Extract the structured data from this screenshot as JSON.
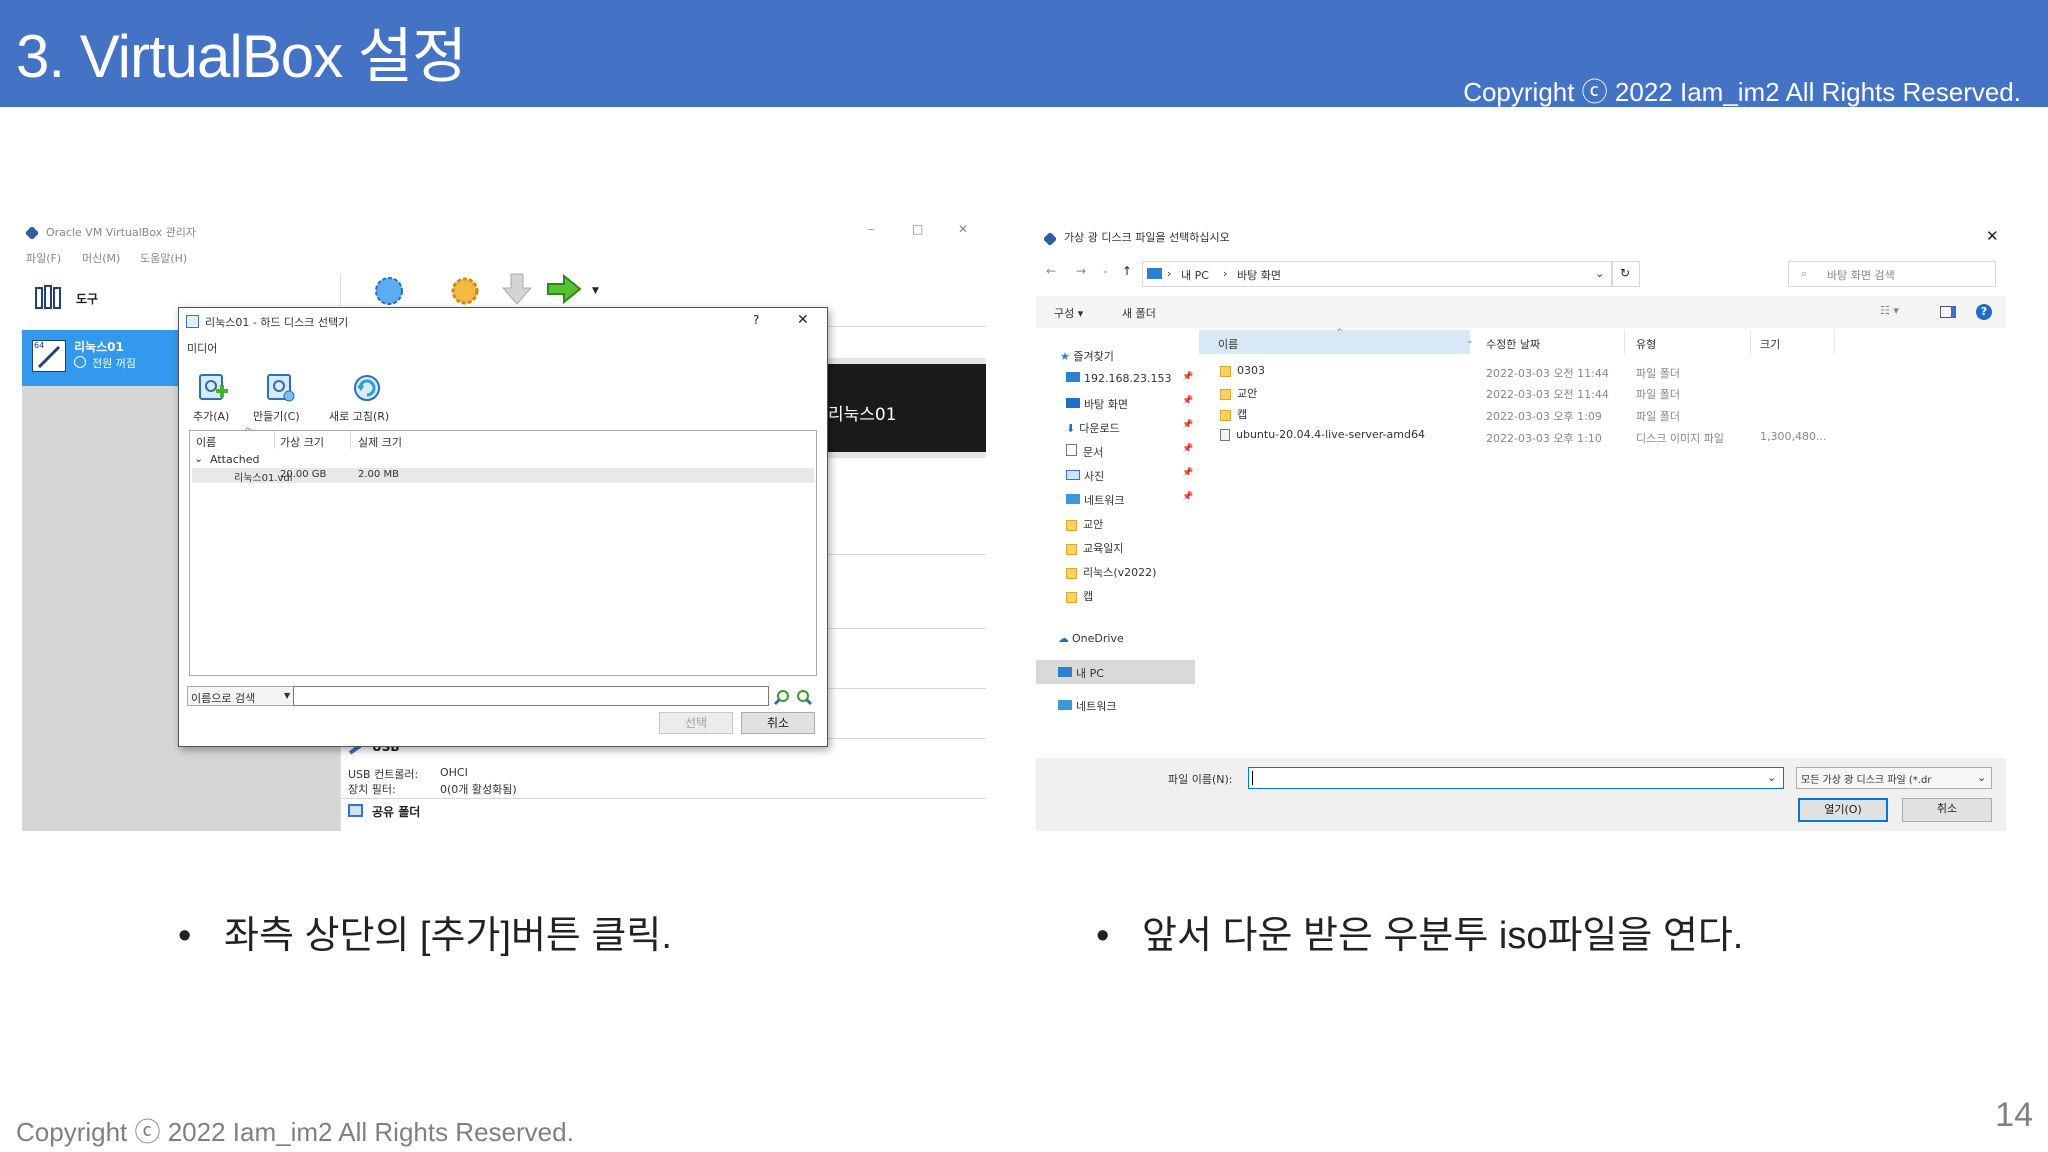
{
  "header": {
    "title": "3. VirtualBox 설정",
    "copyright": "Copyright ⓒ 2022 Iam_im2 All Rights Reserved."
  },
  "footer": {
    "copyright": "Copyright ⓒ 2022 Iam_im2 All Rights Reserved.",
    "page_number": "14"
  },
  "bullets": {
    "left": "좌측 상단의 [추가]버튼 클릭.",
    "right": "앞서 다운 받은 우분투 iso파일을 연다.",
    "marker": "•"
  },
  "vbox": {
    "window_title": "Oracle VM VirtualBox 관리자",
    "menu": [
      "파일(F)",
      "머신(M)",
      "도움말(H)"
    ],
    "window_controls": [
      "–",
      "□",
      "✕"
    ],
    "tools_label": "도구",
    "vm_name": "리눅스01",
    "vm_state": "전원 꺼짐",
    "vm_badge": "64",
    "preview_label": "리눅스01",
    "usb_section": "USB",
    "usb_controller_label": "USB 컨트롤러:",
    "usb_controller_value": "OHCI",
    "usb_filter_label": "장치 필터:",
    "usb_filter_value": "0(0개 활성화됨)",
    "shared_folder": "공유 폴더",
    "dialog": {
      "title": "리눅스01 - 하드 디스크 선택기",
      "help": "?",
      "close": "✕",
      "menu": "미디어",
      "toolbar": [
        {
          "label": "추가(A)",
          "icon": "add-disk-icon"
        },
        {
          "label": "만들기(C)",
          "icon": "create-disk-icon"
        },
        {
          "label": "새로 고침(R)",
          "icon": "refresh-icon"
        }
      ],
      "columns": [
        "이름",
        "가상 크기",
        "실제 크기"
      ],
      "group": "Attached",
      "row": {
        "name": "리눅스01.vdi",
        "virtual_size": "20.00 GB",
        "actual_size": "2.00 MB"
      },
      "search_mode": "이름으로 검색",
      "search_value": "",
      "choose_button": "선택",
      "cancel_button": "취소"
    }
  },
  "filedlg": {
    "title": "가상 광 디스크 파일을 선택하십시오",
    "close": "✕",
    "breadcrumb": [
      "내 PC",
      "바탕 화면"
    ],
    "search_placeholder": "바탕 화면 검색",
    "organize": "구성 ▾",
    "new_folder": "새 폴더",
    "columns": [
      "이름",
      "수정한 날짜",
      "유형",
      "크기"
    ],
    "nav_quick": "즐겨찾기",
    "nav_items": [
      {
        "label": "192.168.23.153",
        "pinned": true
      },
      {
        "label": "바탕 화면",
        "pinned": true
      },
      {
        "label": "다운로드",
        "pinned": true
      },
      {
        "label": "문서",
        "pinned": true
      },
      {
        "label": "사진",
        "pinned": true
      },
      {
        "label": "네트워크",
        "pinned": true
      },
      {
        "label": "교안",
        "pinned": false
      },
      {
        "label": "교육일지",
        "pinned": false
      },
      {
        "label": "리눅스(v2022)",
        "pinned": false
      },
      {
        "label": "캡",
        "pinned": false
      }
    ],
    "nav_onedrive": "OneDrive",
    "nav_pc": "내 PC",
    "nav_network": "네트워크",
    "files": [
      {
        "name": "0303",
        "date": "2022-03-03 오전 11:44",
        "type": "파일 폴더",
        "size": ""
      },
      {
        "name": "교안",
        "date": "2022-03-03 오전 11:44",
        "type": "파일 폴더",
        "size": ""
      },
      {
        "name": "캡",
        "date": "2022-03-03 오후 1:09",
        "type": "파일 폴더",
        "size": ""
      },
      {
        "name": "ubuntu-20.04.4-live-server-amd64",
        "date": "2022-03-03 오후 1:10",
        "type": "디스크 이미지 파일",
        "size": "1,300,480..."
      }
    ],
    "filename_label": "파일 이름(N):",
    "filename_value": "",
    "filter": "모든 가상 광 디스크 파일 (*.dr",
    "open_button": "열기(O)",
    "cancel_button": "취소"
  },
  "colors": {
    "header_band": "#4472c4",
    "selection": "#3399ee",
    "footer_text": "#808080"
  }
}
